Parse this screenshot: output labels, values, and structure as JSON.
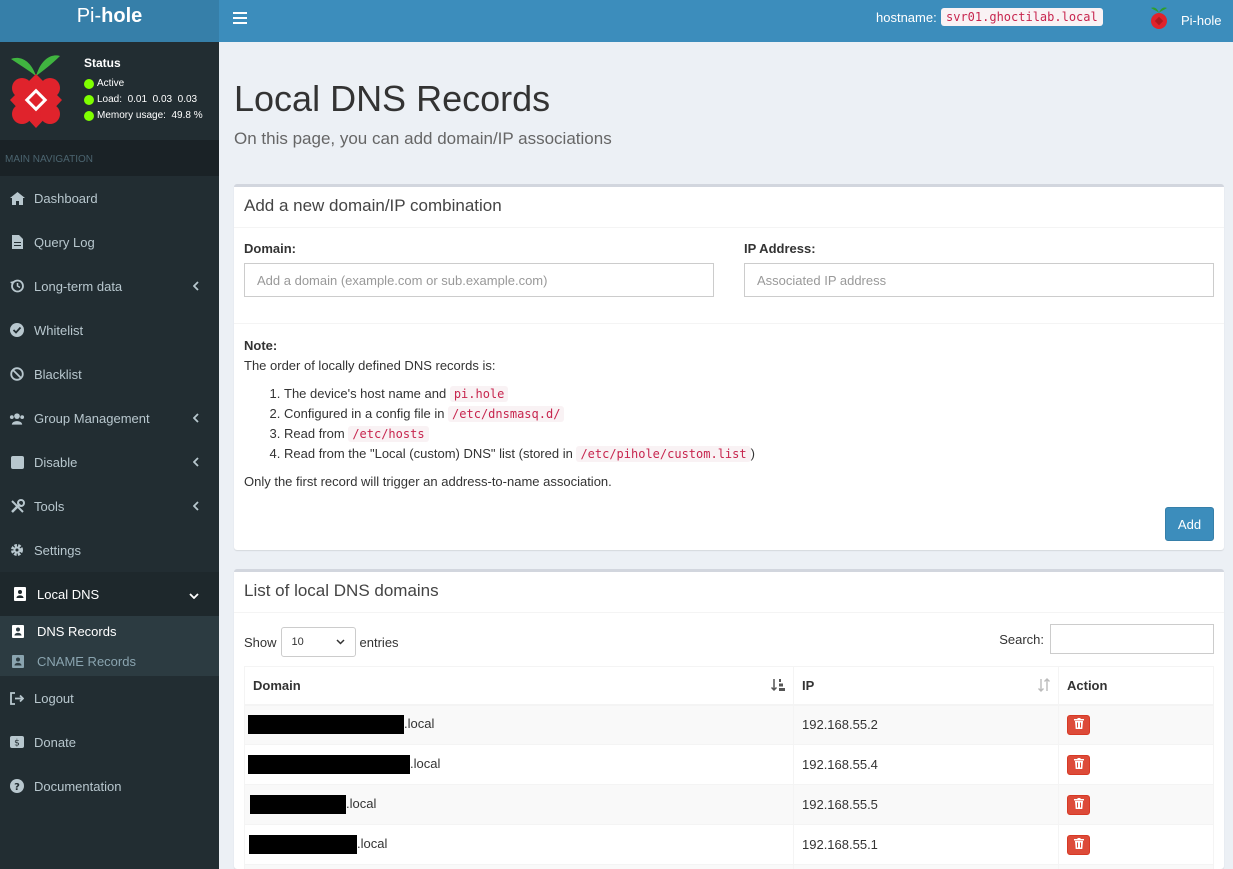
{
  "app": {
    "logo_prefix": "Pi-",
    "logo_bold": "hole"
  },
  "header": {
    "hostname_label": "hostname:",
    "hostname_value": "svr01.ghoctilab.local",
    "user_name": "Pi-hole"
  },
  "status": {
    "title": "Status",
    "active": "Active",
    "load_label": "Load:",
    "load_values": "0.01  0.03  0.03",
    "memory_label": "Memory usage:",
    "memory_value": "49.8 %",
    "dot_color": "#7fff00"
  },
  "sidebar": {
    "header": "MAIN NAVIGATION",
    "items": [
      {
        "label": "Dashboard",
        "icon": "home-icon"
      },
      {
        "label": "Query Log",
        "icon": "file-icon"
      },
      {
        "label": "Long-term data",
        "icon": "history-icon"
      },
      {
        "label": "Whitelist",
        "icon": "check-circle-icon"
      },
      {
        "label": "Blacklist",
        "icon": "ban-icon"
      },
      {
        "label": "Group Management",
        "icon": "users-icon"
      },
      {
        "label": "Disable",
        "icon": "stop-icon"
      },
      {
        "label": "Tools",
        "icon": "tools-icon"
      },
      {
        "label": "Settings",
        "icon": "gear-icon"
      },
      {
        "label": "Local DNS",
        "icon": "address-book-icon"
      },
      {
        "label": "Logout",
        "icon": "sign-out-icon"
      },
      {
        "label": "Donate",
        "icon": "dollar-icon"
      },
      {
        "label": "Documentation",
        "icon": "question-icon"
      }
    ],
    "submenu": [
      {
        "label": "DNS Records",
        "icon": "address-book-icon"
      },
      {
        "label": "CNAME Records",
        "icon": "address-book-icon"
      }
    ]
  },
  "page": {
    "title": "Local DNS Records",
    "subtitle": "On this page, you can add domain/IP associations"
  },
  "add_box": {
    "title": "Add a new domain/IP combination",
    "domain_label": "Domain:",
    "domain_placeholder": "Add a domain (example.com or sub.example.com)",
    "ip_label": "IP Address:",
    "ip_placeholder": "Associated IP address",
    "note_title": "Note:",
    "note_intro": "The order of locally defined DNS records is:",
    "note_items": [
      {
        "text": "The device's host name and ",
        "code": "pi.hole",
        "suffix": ""
      },
      {
        "text": "Configured in a config file in ",
        "code": "/etc/dnsmasq.d/",
        "suffix": ""
      },
      {
        "text": "Read from ",
        "code": "/etc/hosts",
        "suffix": ""
      },
      {
        "text": "Read from the \"Local (custom) DNS\" list (stored in ",
        "code": "/etc/pihole/custom.list",
        "suffix": ")"
      }
    ],
    "note_footer": "Only the first record will trigger an address-to-name association.",
    "add_button": "Add"
  },
  "list_box": {
    "title": "List of local DNS domains",
    "show_label": "Show",
    "entries_value": "10",
    "entries_label": "entries",
    "search_label": "Search:",
    "columns": [
      "Domain",
      "IP",
      "Action"
    ],
    "rows": [
      {
        "domain_suffix": ".local",
        "ip": "192.168.55.2"
      },
      {
        "domain_suffix": ".local",
        "ip": "192.168.55.4"
      },
      {
        "domain_suffix": ".local",
        "ip": "192.168.55.5"
      },
      {
        "domain_suffix": ".local",
        "ip": "192.168.55.1"
      }
    ]
  }
}
